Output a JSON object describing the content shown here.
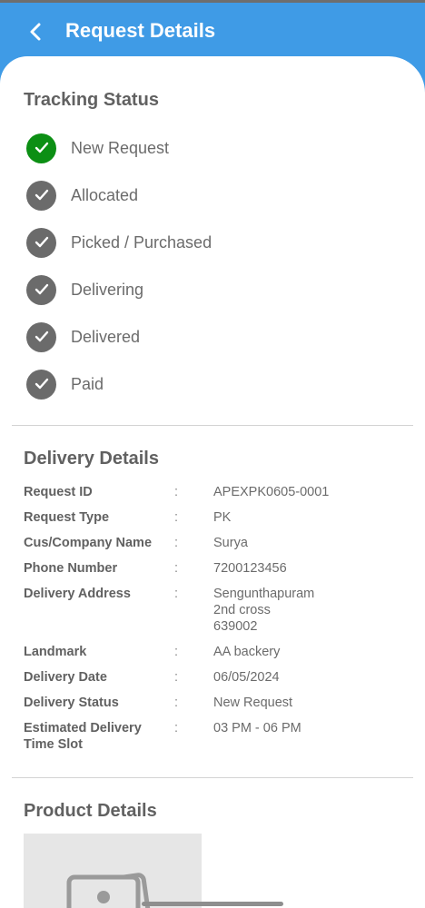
{
  "header": {
    "title": "Request Details"
  },
  "tracking": {
    "title": "Tracking Status",
    "steps": [
      {
        "label": "New Request",
        "state": "done"
      },
      {
        "label": "Allocated",
        "state": "pending"
      },
      {
        "label": "Picked / Purchased",
        "state": "pending"
      },
      {
        "label": "Delivering",
        "state": "pending"
      },
      {
        "label": "Delivered",
        "state": "pending"
      },
      {
        "label": "Paid",
        "state": "pending"
      }
    ]
  },
  "delivery": {
    "title": "Delivery Details",
    "separator": ":",
    "fields": [
      {
        "label": "Request ID",
        "value": "APEXPK0605-0001"
      },
      {
        "label": "Request Type",
        "value": "PK"
      },
      {
        "label": "Cus/Company Name",
        "value": "Surya"
      },
      {
        "label": "Phone Number",
        "value": "7200123456"
      },
      {
        "label": "Delivery Address",
        "value_lines": [
          "Sengunthapuram",
          "2nd cross",
          "639002"
        ]
      },
      {
        "label": "Landmark",
        "value": "AA backery"
      },
      {
        "label": "Delivery Date",
        "value": "06/05/2024"
      },
      {
        "label": "Delivery Status",
        "value": "New Request"
      },
      {
        "label": "Estimated Delivery",
        "label2": "Time Slot",
        "value": "03 PM - 06 PM"
      }
    ]
  },
  "product": {
    "title": "Product Details"
  },
  "colors": {
    "accent": "#3f9be6",
    "done": "#0c8f14",
    "pending": "#6b6b6b"
  }
}
